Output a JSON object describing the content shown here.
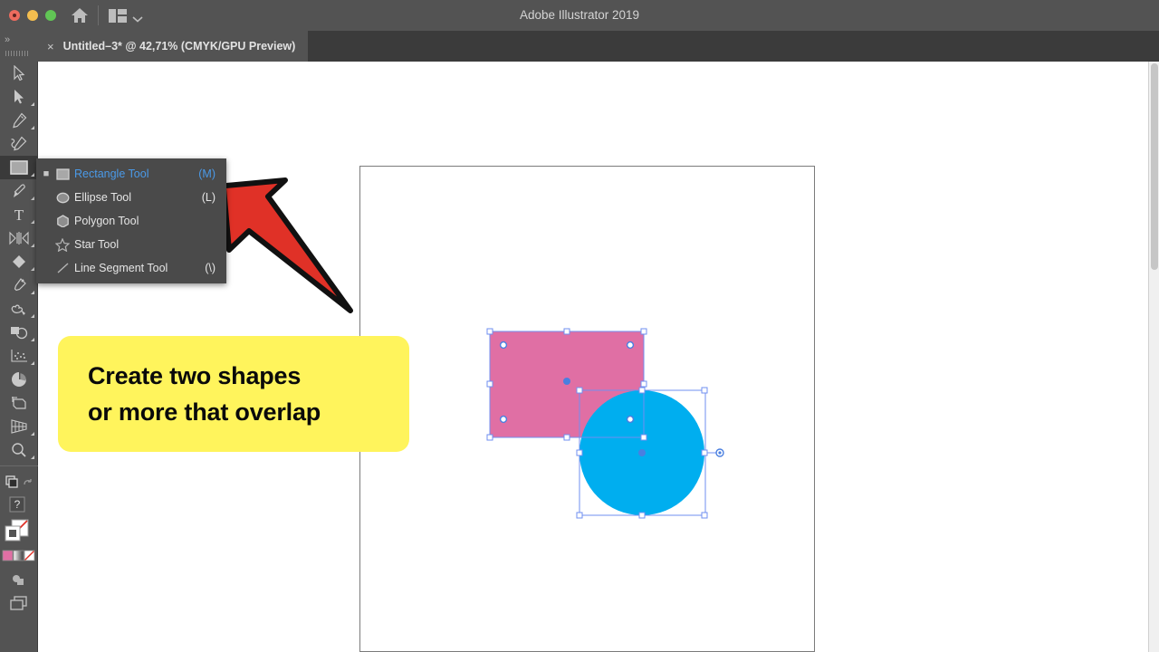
{
  "window": {
    "title": "Adobe Illustrator 2019",
    "traffic_lights": [
      "close-red",
      "minimize-yellow",
      "maximize-green"
    ],
    "home_icon": "home-icon",
    "layout_icon": "arrange-documents-icon",
    "chevron_icon": "chevron-down-icon"
  },
  "tabbar": {
    "panel_toggle": "»",
    "tab_close": "×",
    "tab_label": "Untitled–3* @ 42,71% (CMYK/GPU Preview)"
  },
  "toolbar": {
    "tools": [
      {
        "name": "selection-tool",
        "has_corner": false
      },
      {
        "name": "direct-selection-tool",
        "has_corner": true
      },
      {
        "name": "pen-tool",
        "has_corner": true
      },
      {
        "name": "curvature-tool",
        "has_corner": false
      },
      {
        "name": "rectangle-tool",
        "has_corner": true,
        "active": true
      },
      {
        "name": "paintbrush-tool",
        "has_corner": true
      },
      {
        "name": "type-tool",
        "has_corner": true
      },
      {
        "name": "width-tool",
        "has_corner": true
      },
      {
        "name": "shape-builder-tool",
        "has_corner": true
      },
      {
        "name": "eyedropper-tool",
        "has_corner": true
      },
      {
        "name": "symbol-sprayer-tool",
        "has_corner": true
      },
      {
        "name": "free-transform-tool",
        "has_corner": true
      },
      {
        "name": "graph-tool",
        "has_corner": true
      },
      {
        "name": "pie-graph-tool",
        "has_corner": false
      },
      {
        "name": "artboard-tool",
        "has_corner": false
      },
      {
        "name": "perspective-grid-tool",
        "has_corner": true
      },
      {
        "name": "zoom-tool",
        "has_corner": true
      }
    ],
    "footer": {
      "screen_mode_icon": "change-screen-mode-icon",
      "undo_icon": "edit-toolbar-icon",
      "help_icon": "question-mark-icon",
      "fill_stroke": "fill-and-stroke-swatches",
      "color_modes": "color-gradient-none-swatches",
      "drawing_mode_icon": "drawing-mode-icon",
      "screen_icon": "screen-mode-icon"
    }
  },
  "flyout_menu": {
    "items": [
      {
        "label": "Rectangle Tool",
        "shortcut": "(M)",
        "icon": "rectangle-icon",
        "selected": true
      },
      {
        "label": "Ellipse Tool",
        "shortcut": "(L)",
        "icon": "ellipse-icon",
        "selected": false
      },
      {
        "label": "Polygon Tool",
        "shortcut": "",
        "icon": "polygon-icon",
        "selected": false
      },
      {
        "label": "Star Tool",
        "shortcut": "",
        "icon": "star-icon",
        "selected": false
      },
      {
        "label": "Line Segment Tool",
        "shortcut": "(\\)",
        "icon": "line-segment-icon",
        "selected": false
      }
    ]
  },
  "callout": {
    "line1": "Create two shapes",
    "line2": "or more that overlap",
    "background": "#FFF45C",
    "arrow_color": "#E03127"
  },
  "canvas": {
    "shapes": [
      {
        "name": "pink-rectangle",
        "type": "rectangle",
        "fill": "#E06FA4",
        "selected": true
      },
      {
        "name": "blue-circle",
        "type": "ellipse",
        "fill": "#00AEEF",
        "selected": true
      }
    ],
    "selection_color": "#4a7fe0"
  }
}
